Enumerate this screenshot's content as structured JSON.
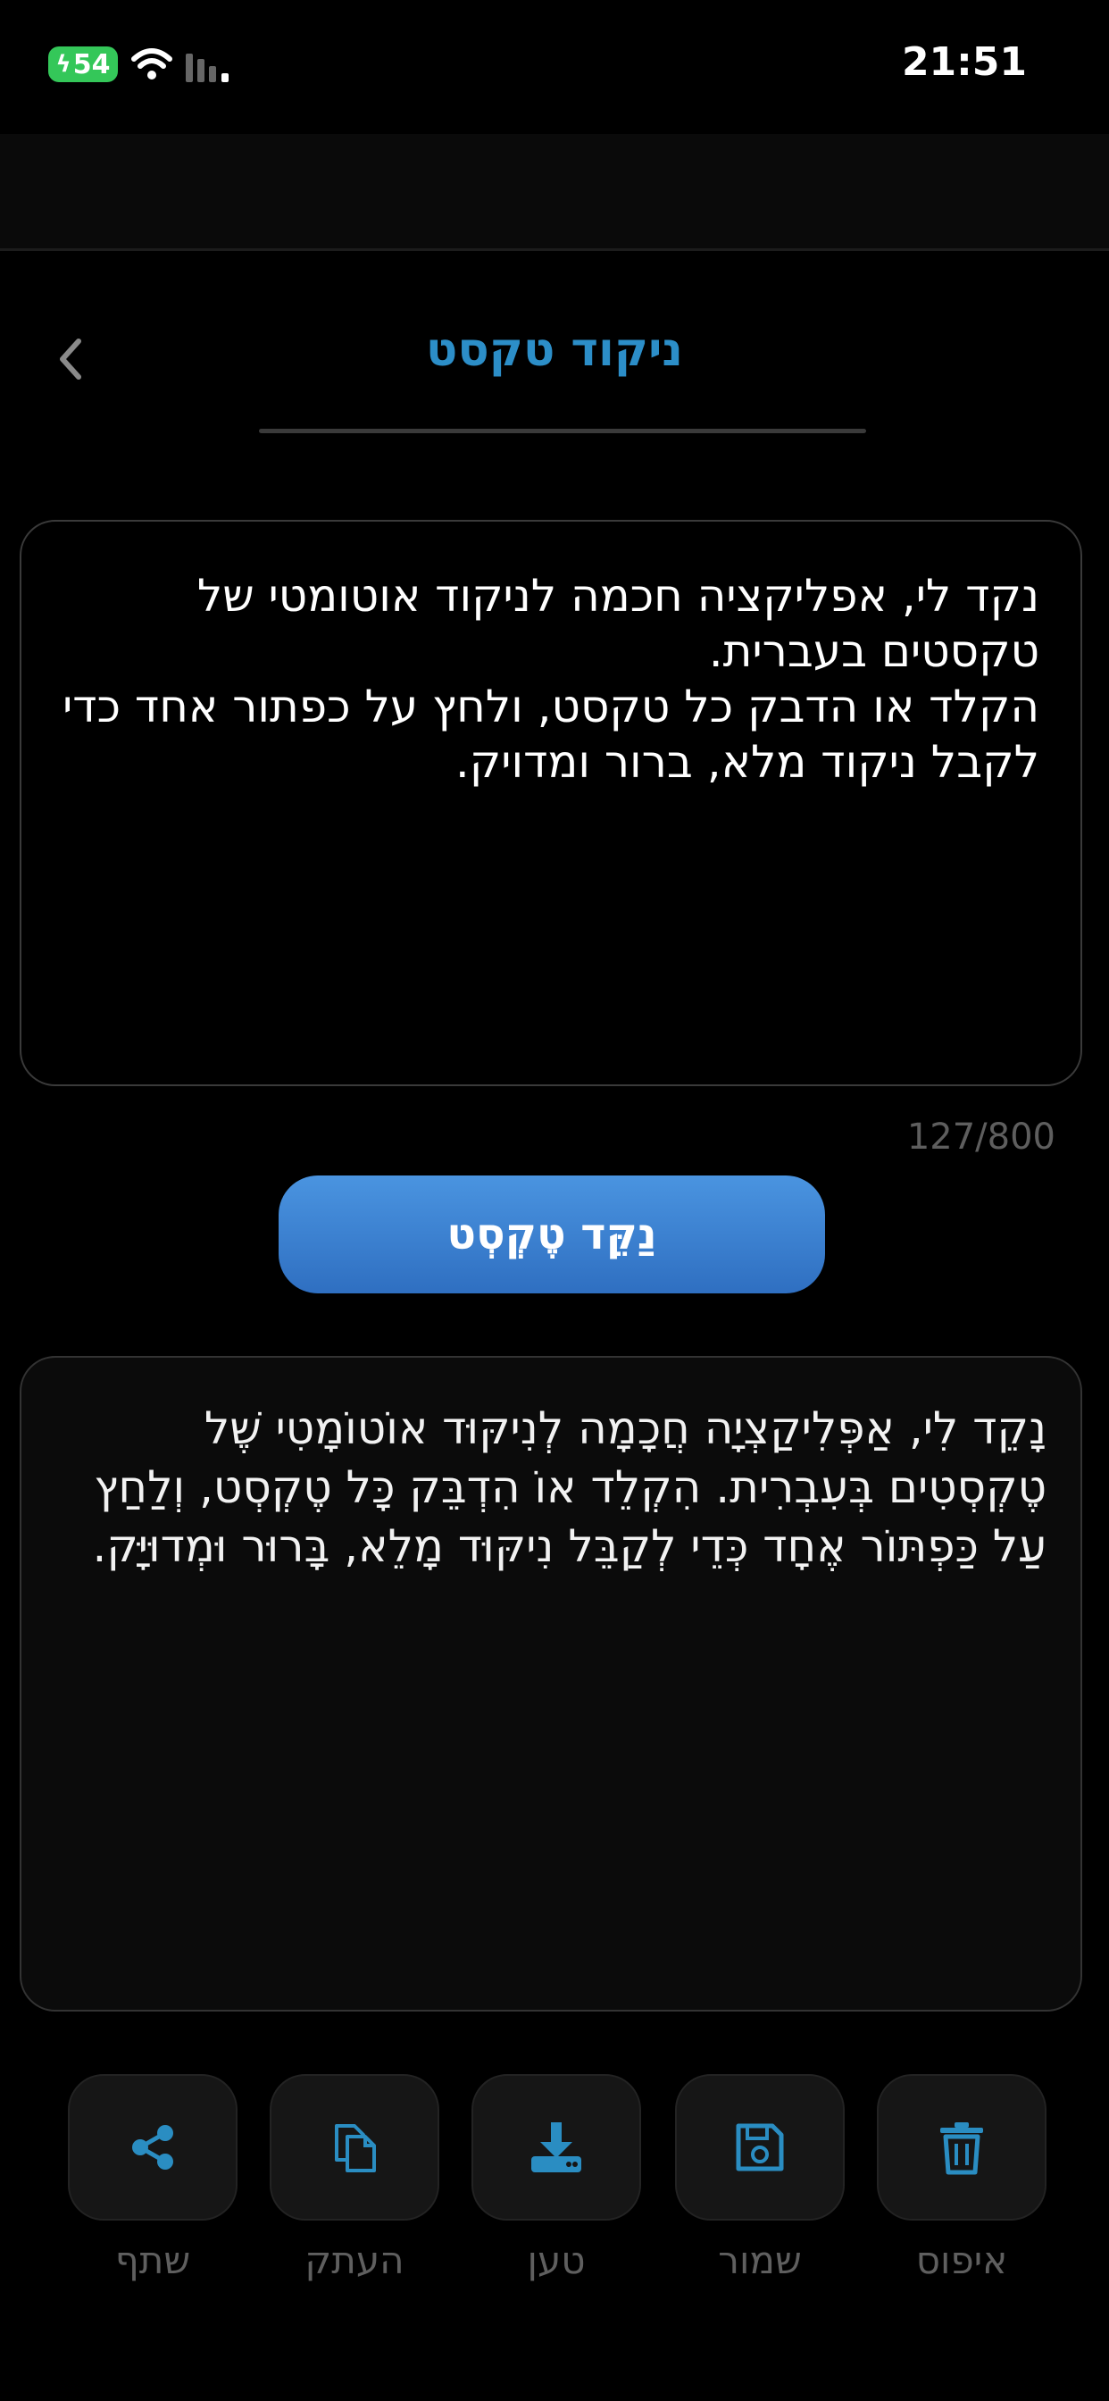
{
  "status_bar": {
    "battery": "54",
    "time": "21:51"
  },
  "header": {
    "title": "ניקוד טקסט"
  },
  "input": {
    "text": "נקד לי, אפליקציה חכמה לניקוד אוטומטי של טקסטים בעברית.\nהקלד או הדבק כל טקסט, ולחץ על כפתור אחד כדי לקבל ניקוד מלא, ברור ומדויק.",
    "counter": "127/800"
  },
  "nakdan_button": {
    "label": "נַקֵּד טֶקְסְט"
  },
  "output": {
    "text": "נָקֵד לִי, אַפְּלִיקַצְיָה חֲכָמָה לְנִיקּוּד אוֹטוֹמָטִי שֶׁל טֶקְסְטִים בְּעִבְרִית. הִקְלֵד אוֹ הִדְבֵּק כָּל טֶקְסְט, וְלַחַץ עַל כַּפְתּוֹר אֶחָד כְּדֵי לְקַבֵּל נִיקּוּד מָלֵא, בָּרוּר וּמְדוּיָּק."
  },
  "actions": {
    "reset": "איפוס",
    "save": "שמור",
    "load": "טען",
    "copy": "העתק",
    "share": "שתף"
  },
  "colors": {
    "accent": "#2c8ec8",
    "button": "#3a82d2",
    "battery": "#34c759"
  }
}
